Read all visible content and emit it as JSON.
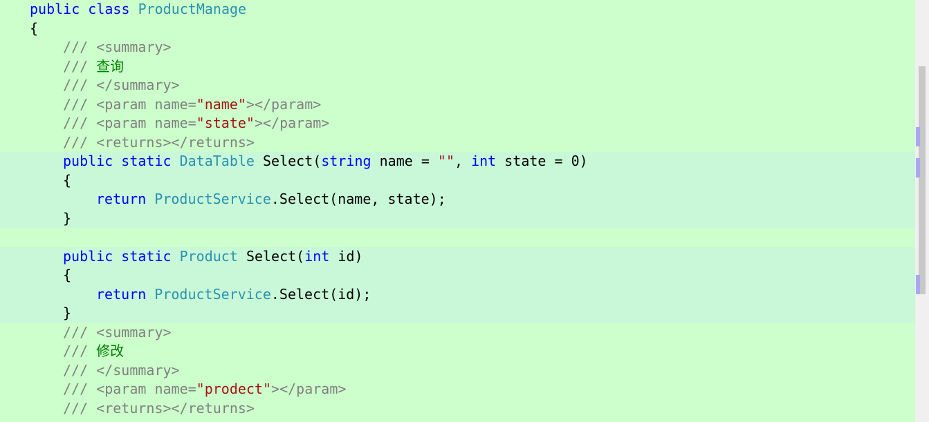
{
  "code": {
    "l1": {
      "kw1": "public",
      "kw2": "class",
      "type": "ProductManage"
    },
    "l2": {
      "brace": "{"
    },
    "l3": {
      "slashes": "///",
      "tag": "<summary>"
    },
    "l4": {
      "slashes": "///",
      "text": "查询"
    },
    "l5": {
      "slashes": "///",
      "tag": "</summary>"
    },
    "l6": {
      "slashes": "///",
      "a": "<param name=",
      "q": "\"name\"",
      "b": "></param>"
    },
    "l7": {
      "slashes": "///",
      "a": "<param name=",
      "q": "\"state\"",
      "b": "></param>"
    },
    "l8": {
      "slashes": "///",
      "tag": "<returns></returns>"
    },
    "l9": {
      "kw1": "public",
      "kw2": "static",
      "type": "DataTable",
      "name": "Select(",
      "kw3": "string",
      "p1": "name =",
      "str": "\"\"",
      "comma": ",",
      "kw4": "int",
      "p2": "state = 0)"
    },
    "l10": {
      "brace": "{"
    },
    "l11": {
      "kw": "return",
      "type": "ProductService",
      "rest": ".Select(name, state);"
    },
    "l12": {
      "brace": "}"
    },
    "l14": {
      "kw1": "public",
      "kw2": "static",
      "type": "Product",
      "name": "Select(",
      "kw3": "int",
      "rest": "id)"
    },
    "l15": {
      "brace": "{"
    },
    "l16": {
      "kw": "return",
      "type": "ProductService",
      "rest": ".Select(id);"
    },
    "l17": {
      "brace": "}"
    },
    "l18": {
      "slashes": "///",
      "tag": "<summary>"
    },
    "l19": {
      "slashes": "///",
      "text": "修改"
    },
    "l20": {
      "slashes": "///",
      "tag": "</summary>"
    },
    "l21": {
      "slashes": "///",
      "a": "<param name=",
      "q": "\"prodect\"",
      "b": "></param>"
    },
    "l22": {
      "slashes": "///",
      "tag": "<returns></returns>"
    }
  },
  "colors": {
    "background": "#ccffcc",
    "keyword": "#0000ff",
    "type": "#2b91af",
    "comment": "#808080",
    "comment_text": "#008000",
    "string": "#a31515"
  }
}
